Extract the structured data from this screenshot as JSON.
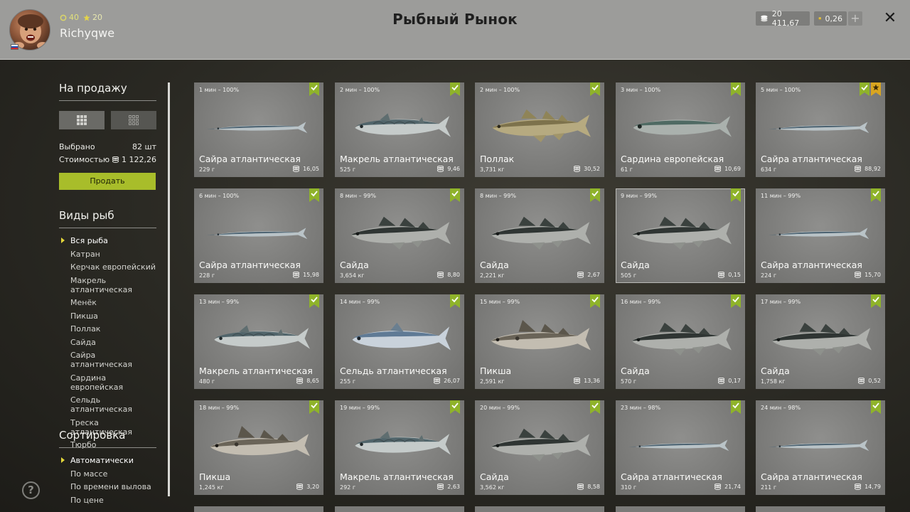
{
  "header": {
    "title": "Рыбный Рынок",
    "username": "Richyqwe",
    "coins_stat": "40",
    "level_stat": "20",
    "silver": "20 411,67",
    "gold": "0,26",
    "plus": "+",
    "close": "✕"
  },
  "sidebar": {
    "sale_heading": "На продажу",
    "selected_label": "Выбрано",
    "selected_value": "82 шт",
    "cost_label": "Стоимостью",
    "cost_value": "1 122,26",
    "sell_button": "Продать",
    "types_heading": "Виды рыб",
    "types": [
      "Вся рыба",
      "Катран",
      "Керчак европейский",
      "Макрель атлантическая",
      "Менёк",
      "Пикша",
      "Поллак",
      "Сайда",
      "Сайра атлантическая",
      "Сардина европейская",
      "Сельдь атлантическая",
      "Треска атлантическая",
      "Тюрбо"
    ],
    "sort_heading": "Сортировка",
    "sorts": [
      "Автоматически",
      "По массе",
      "По времени вылова",
      "По цене"
    ],
    "help": "?"
  },
  "colors": {
    "accent": "#a8bd2a",
    "check": "#8fb32a",
    "star": "#d9a520"
  },
  "cards": [
    {
      "time": "1 мин – 100%",
      "name": "Сайра атлантическая",
      "weight": "229 г",
      "price": "16,05",
      "fish": "saury"
    },
    {
      "time": "2 мин – 100%",
      "name": "Макрель атлантическая",
      "weight": "525 г",
      "price": "9,46",
      "fish": "mackerel"
    },
    {
      "time": "2 мин – 100%",
      "name": "Поллак",
      "weight": "3,731 кг",
      "price": "30,52",
      "fish": "pollack"
    },
    {
      "time": "3 мин – 100%",
      "name": "Сардина европейская",
      "weight": "61 г",
      "price": "10,69",
      "fish": "sardine"
    },
    {
      "time": "5 мин – 100%",
      "name": "Сайра атлантическая",
      "weight": "634 г",
      "price": "88,92",
      "fish": "saury",
      "star": true
    },
    {
      "time": "6 мин – 100%",
      "name": "Сайра атлантическая",
      "weight": "228 г",
      "price": "15,98",
      "fish": "saury"
    },
    {
      "time": "8 мин – 99%",
      "name": "Сайда",
      "weight": "3,654 кг",
      "price": "8,80",
      "fish": "saithe"
    },
    {
      "time": "8 мин – 99%",
      "name": "Сайда",
      "weight": "2,221 кг",
      "price": "2,67",
      "fish": "saithe"
    },
    {
      "time": "9 мин – 99%",
      "name": "Сайда",
      "weight": "505 г",
      "price": "0,15",
      "fish": "saithe",
      "outlined": true
    },
    {
      "time": "11 мин – 99%",
      "name": "Сайра атлантическая",
      "weight": "224 г",
      "price": "15,70",
      "fish": "saury"
    },
    {
      "time": "13 мин – 99%",
      "name": "Макрель атлантическая",
      "weight": "480 г",
      "price": "8,65",
      "fish": "mackerel"
    },
    {
      "time": "14 мин – 99%",
      "name": "Сельдь атлантическая",
      "weight": "255 г",
      "price": "26,07",
      "fish": "herring"
    },
    {
      "time": "15 мин – 99%",
      "name": "Пикша",
      "weight": "2,591 кг",
      "price": "13,36",
      "fish": "haddock"
    },
    {
      "time": "16 мин – 99%",
      "name": "Сайда",
      "weight": "570 г",
      "price": "0,17",
      "fish": "saithe"
    },
    {
      "time": "17 мин – 99%",
      "name": "Сайда",
      "weight": "1,758 кг",
      "price": "0,52",
      "fish": "saithe"
    },
    {
      "time": "18 мин – 99%",
      "name": "Пикша",
      "weight": "1,245 кг",
      "price": "3,20",
      "fish": "haddock"
    },
    {
      "time": "19 мин – 99%",
      "name": "Макрель атлантическая",
      "weight": "292 г",
      "price": "2,63",
      "fish": "mackerel"
    },
    {
      "time": "20 мин – 99%",
      "name": "Сайда",
      "weight": "3,562 кг",
      "price": "8,58",
      "fish": "saithe"
    },
    {
      "time": "23 мин – 98%",
      "name": "Сайра атлантическая",
      "weight": "310 г",
      "price": "21,74",
      "fish": "saury"
    },
    {
      "time": "24 мин – 98%",
      "name": "Сайра атлантическая",
      "weight": "211 г",
      "price": "14,79",
      "fish": "saury"
    }
  ]
}
